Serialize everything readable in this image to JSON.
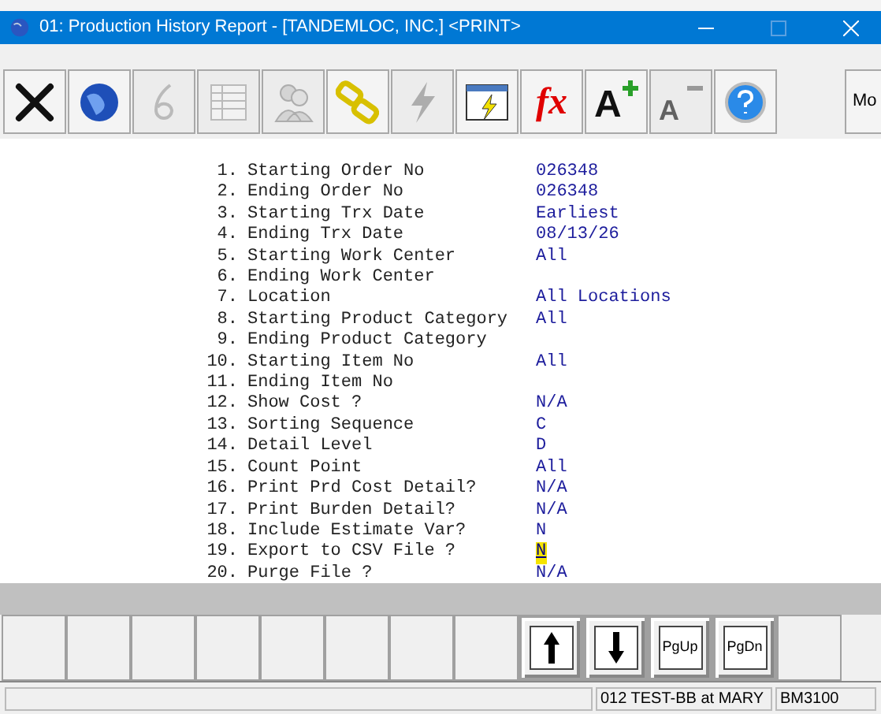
{
  "window": {
    "title": "01: Production History Report - [TANDEMLOC, INC.] <PRINT>"
  },
  "toolbar": [
    {
      "kind": "close",
      "disabled": false
    },
    {
      "kind": "globe",
      "disabled": false
    },
    {
      "kind": "six",
      "disabled": true
    },
    {
      "kind": "table",
      "disabled": true
    },
    {
      "kind": "people",
      "disabled": true
    },
    {
      "kind": "link",
      "disabled": false
    },
    {
      "kind": "bolt",
      "disabled": true
    },
    {
      "kind": "window-bolt",
      "disabled": false
    },
    {
      "kind": "fx",
      "label": "fx",
      "disabled": false
    },
    {
      "kind": "font-up",
      "label": "A",
      "disabled": false
    },
    {
      "kind": "font-down",
      "label": "A",
      "disabled": true
    },
    {
      "kind": "help",
      "disabled": false
    }
  ],
  "toolbar_overflow": {
    "label": "Mo"
  },
  "fields": [
    {
      "number": "1.",
      "label": "Starting Order No",
      "value": "026348",
      "selected": false
    },
    {
      "number": "2.",
      "label": "Ending Order No",
      "value": "026348",
      "selected": false
    },
    {
      "number": "3.",
      "label": "Starting Trx Date",
      "value": "Earliest",
      "selected": false
    },
    {
      "number": "4.",
      "label": "Ending Trx Date",
      "value": "08/13/26",
      "selected": false
    },
    {
      "number": "5.",
      "label": "Starting Work Center",
      "value": "All",
      "selected": false
    },
    {
      "number": "6.",
      "label": "Ending Work Center",
      "selected": false
    },
    {
      "number": "7.",
      "label": "Location",
      "value": "All Locations",
      "selected": false
    },
    {
      "number": "8.",
      "label": "Starting Product Category",
      "value": "All",
      "selected": false
    },
    {
      "number": "9.",
      "label": "Ending Product Category",
      "selected": false
    },
    {
      "number": "10.",
      "label": "Starting Item No",
      "value": "All",
      "selected": false
    },
    {
      "number": "11.",
      "label": "Ending Item No",
      "selected": false
    },
    {
      "number": "12.",
      "label": "Show Cost ?",
      "value": "N/A",
      "selected": false
    },
    {
      "number": "13.",
      "label": "Sorting Sequence",
      "value": "C",
      "selected": false
    },
    {
      "number": "14.",
      "label": "Detail Level",
      "value": "D",
      "selected": false
    },
    {
      "number": "15.",
      "label": "Count Point",
      "value": "All",
      "selected": false
    },
    {
      "number": "16.",
      "label": "Print Prd Cost Detail?",
      "value": "N/A",
      "selected": false
    },
    {
      "number": "17.",
      "label": "Print Burden Detail?",
      "value": "N/A",
      "selected": false
    },
    {
      "number": "18.",
      "label": "Include Estimate Var?",
      "value": "N",
      "selected": false
    },
    {
      "number": "19.",
      "label": "Export to CSV File ?",
      "value": "N",
      "selected": true
    },
    {
      "number": "20.",
      "label": "Purge File ?",
      "value": "N/A",
      "selected": false
    }
  ],
  "function_keys": [
    {
      "kind": "blank"
    },
    {
      "kind": "blank"
    },
    {
      "kind": "blank"
    },
    {
      "kind": "blank"
    },
    {
      "kind": "blank"
    },
    {
      "kind": "blank"
    },
    {
      "kind": "blank"
    },
    {
      "kind": "blank"
    },
    {
      "kind": "up"
    },
    {
      "kind": "down"
    },
    {
      "kind": "text",
      "label": "PgUp"
    },
    {
      "kind": "text",
      "label": "PgDn"
    },
    {
      "kind": "blank"
    }
  ],
  "status_bar": [
    "012 TEST-BB at MARY",
    "BM3100"
  ]
}
